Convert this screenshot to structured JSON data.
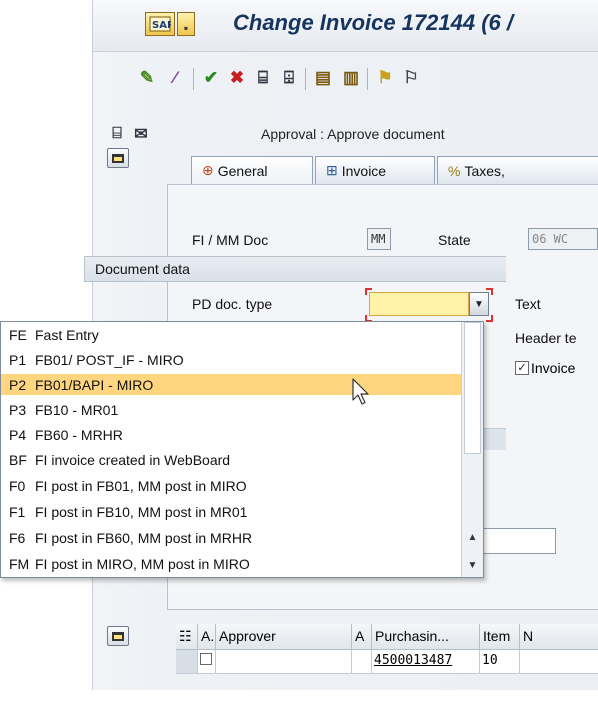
{
  "window": {
    "title": "Change Invoice 172144 (6 /"
  },
  "approval": {
    "status_text": "Approval : Approve document"
  },
  "tabs": [
    {
      "label": "General",
      "icon": "general-icon"
    },
    {
      "label": "Invoice",
      "icon": "invoice-icon"
    },
    {
      "label": "Taxes,",
      "icon": "taxes-icon"
    }
  ],
  "general": {
    "fi_mm_doc_label": "FI / MM Doc",
    "fi_mm_doc_value": "MM",
    "state_label": "State",
    "state_value": "06 WC",
    "section_header": "Document data",
    "pd_doc_type_label": "PD doc. type",
    "pd_doc_type_value": "",
    "text_label": "Text",
    "header_text_label": "Header te",
    "invoice_checkbox_label": "Invoice",
    "invoice_checked": true
  },
  "dropdown": {
    "selected_code": "P2",
    "items": [
      {
        "code": "FE",
        "desc": "Fast Entry"
      },
      {
        "code": "P1",
        "desc": "FB01/ POST_IF - MIRO"
      },
      {
        "code": "P2",
        "desc": "FB01/BAPI - MIRO"
      },
      {
        "code": "P3",
        "desc": "FB10 - MR01"
      },
      {
        "code": "P4",
        "desc": "FB60 - MRHR"
      },
      {
        "code": "BF",
        "desc": "FI invoice created in WebBoard"
      },
      {
        "code": "F0",
        "desc": "FI post in FB01, MM post in MIRO"
      },
      {
        "code": "F1",
        "desc": "FI post in FB10, MM post in MR01"
      },
      {
        "code": "F6",
        "desc": "FI post in FB60, MM post in MRHR"
      },
      {
        "code": "FM",
        "desc": "FI post in MIRO, MM post in MIRO"
      }
    ]
  },
  "table": {
    "headers": {
      "a": "A..",
      "approver": "Approver",
      "a2": "A",
      "purchasing": "Purchasin...",
      "item": "Item",
      "n": "N"
    },
    "row": {
      "purchasing": "4500013487",
      "item": "10"
    }
  },
  "colors": {
    "title": "#16345f",
    "selected_row": "#ffd67f",
    "required_field": "#fff1a8",
    "required_marker": "#e0322b"
  }
}
